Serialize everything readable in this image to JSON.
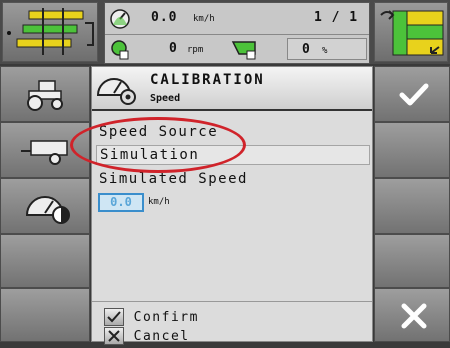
{
  "status": {
    "speed_value": "0.0",
    "speed_unit": "km/h",
    "counter": "1 / 1",
    "rpm_value": "0",
    "rpm_unit": "rpm",
    "percent_value": "0",
    "percent_unit": "%"
  },
  "header": {
    "title": "CALIBRATION",
    "subtitle": "Speed"
  },
  "form": {
    "speed_source_label": "Speed Source",
    "speed_source_value": "Simulation",
    "simulated_speed_label": "Simulated Speed",
    "simulated_speed_value": "0.0",
    "simulated_speed_unit": "km/h"
  },
  "footer": {
    "confirm_label": "Confirm",
    "cancel_label": "Cancel"
  },
  "colors": {
    "annotation": "#d0232a",
    "value_accent": "#3a8ecc"
  },
  "icons": [
    "sprayer-boom-icon",
    "speedometer-icon",
    "engine-rpm-icon",
    "tank-icon",
    "field-map-icon",
    "tractor-icon",
    "trailer-icon",
    "speedometer-settings-icon",
    "checkmark-icon",
    "close-icon"
  ]
}
